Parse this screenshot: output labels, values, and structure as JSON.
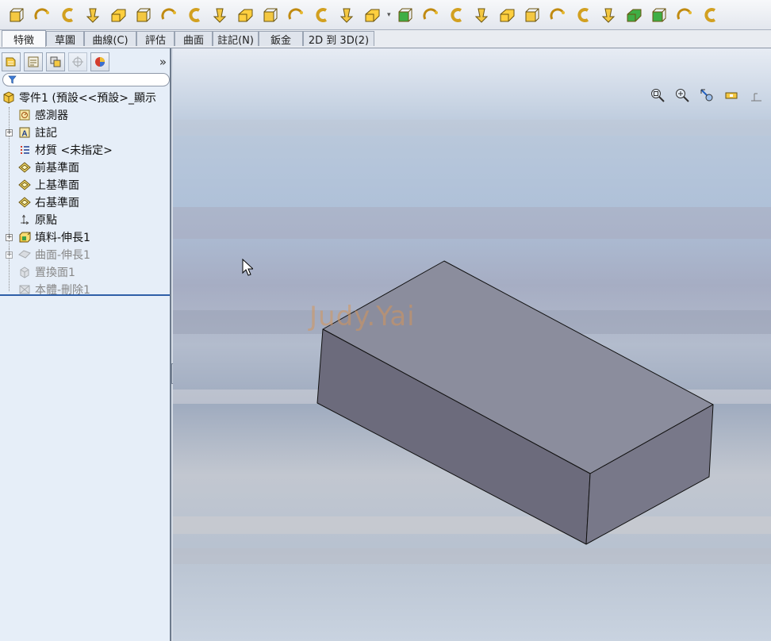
{
  "toolbar": {
    "icons": [
      "extruded-boss-icon",
      "revolved-boss-icon",
      "swept-boss-icon",
      "lofted-boss-icon",
      "boundary-boss-icon",
      "extruded-cut-icon",
      "hole-wizard-icon",
      "revolved-cut-icon",
      "swept-cut-icon",
      "lofted-cut-icon",
      "boundary-cut-icon",
      "fillet-icon",
      "chamfer-icon",
      "shell-icon",
      "linear-pattern-icon",
      "reference-geometry-icon",
      "rib-icon",
      "wrap-icon",
      "intersect-icon",
      "draft-icon",
      "dome-icon",
      "mirror-icon",
      "flex-icon",
      "shape-icon",
      "curves-icon",
      "instant3d-icon",
      "split-icon",
      "combine-icon"
    ]
  },
  "tabs": [
    {
      "label": "特徵",
      "active": true
    },
    {
      "label": "草圖",
      "active": false
    },
    {
      "label": "曲線(C)",
      "active": false
    },
    {
      "label": "評估",
      "active": false
    },
    {
      "label": "曲面",
      "active": false
    },
    {
      "label": "註記(N)",
      "active": false
    },
    {
      "label": "鈑金",
      "active": false
    },
    {
      "label": "2D 到 3D(2)",
      "active": false
    }
  ],
  "panel": {
    "expand_glyph": "»",
    "tree": {
      "root": "零件1 (預設<<預設>_顯示",
      "sensors": "感測器",
      "annotations": "註記",
      "material": "材質 <未指定>",
      "front_plane": "前基準面",
      "top_plane": "上基準面",
      "right_plane": "右基準面",
      "origin": "原點",
      "boss_extrude": "填料-伸長1",
      "surface_extrude": "曲面-伸長1",
      "replace_face": "置換面1",
      "delete_body": "本體-刪除1"
    }
  },
  "viewport": {
    "watermark": "Judy.Yai",
    "model_colors": {
      "top": "#8b8d9d",
      "front": "#6c6b7c",
      "side": "#787889",
      "edge": "#111111"
    }
  }
}
